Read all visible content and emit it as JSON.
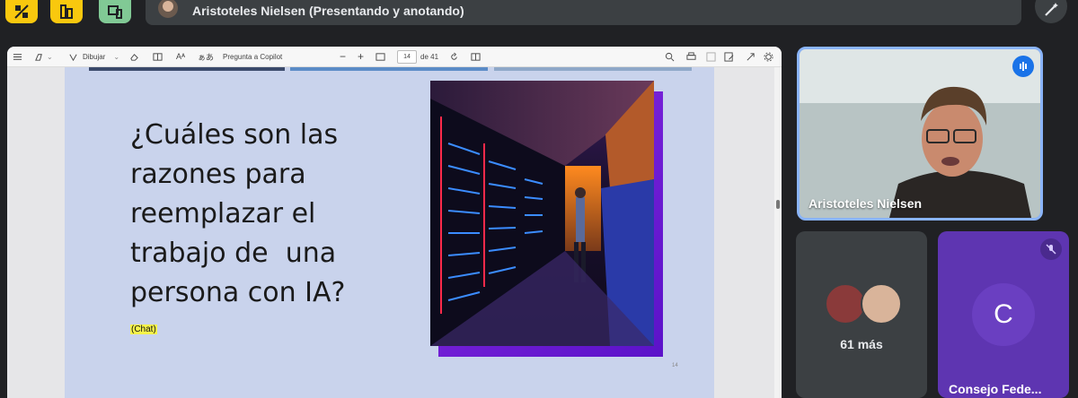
{
  "top_bar": {
    "presenter_label": "Aristoteles Nielsen (Presentando y anotando)"
  },
  "pdf_toolbar": {
    "draw_label": "Dibujar",
    "copilot_label": "Pregunta a Copilot",
    "current_page": "14",
    "total_pages": "de 41"
  },
  "slide": {
    "title_lines": [
      "¿Cuáles son las",
      "razones para",
      "reemplazar el",
      "trabajo de  una",
      "persona con IA?"
    ],
    "chat_tag": "(Chat)",
    "page_number": "14"
  },
  "participants": {
    "main_speaker": "Aristoteles Nielsen",
    "more_label": "61 más",
    "tile_c_initial": "C",
    "tile_c_name": "Consejo Fede..."
  },
  "colors": {
    "accent": "#8ab4f8",
    "yellow_button": "#f9c80e",
    "green_button": "#81c995",
    "tile_purple": "#5e35b1"
  }
}
